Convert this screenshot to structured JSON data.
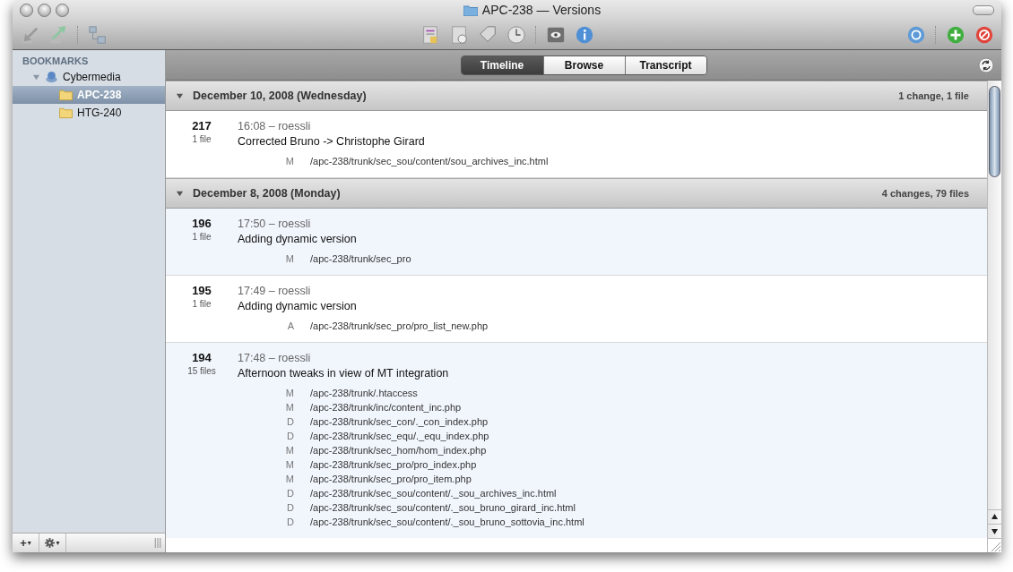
{
  "window": {
    "title": "APC-238 — Versions"
  },
  "sidebar": {
    "heading": "BOOKMARKS",
    "items": [
      {
        "label": "Cybermedia",
        "expanded": true,
        "selected": false,
        "children": [
          {
            "label": "APC-238",
            "selected": true
          },
          {
            "label": "HTG-240",
            "selected": false
          }
        ]
      }
    ]
  },
  "footer": {
    "add_button": "+",
    "menu_caret": "▾"
  },
  "tabs": [
    {
      "label": "Timeline",
      "selected": true
    },
    {
      "label": "Browse",
      "selected": false
    },
    {
      "label": "Transcript",
      "selected": false
    }
  ],
  "days": [
    {
      "date": "December 10, 2008 (Wednesday)",
      "summary": "1 change, 1 file",
      "expanded": true,
      "commits": [
        {
          "revision": "217",
          "files_count": "1 file",
          "time_author": "16:08 – roessli",
          "message": "Corrected Bruno -> Christophe Girard",
          "files": [
            {
              "status": "M",
              "path": "/apc-238/trunk/sec_sou/content/sou_archives_inc.html"
            }
          ]
        }
      ]
    },
    {
      "date": "December 8, 2008 (Monday)",
      "summary": "4 changes, 79 files",
      "expanded": true,
      "commits": [
        {
          "revision": "196",
          "files_count": "1 file",
          "time_author": "17:50 – roessli",
          "message": "Adding dynamic version",
          "files": [
            {
              "status": "M",
              "path": "/apc-238/trunk/sec_pro"
            }
          ]
        },
        {
          "revision": "195",
          "files_count": "1 file",
          "time_author": "17:49 – roessli",
          "message": "Adding dynamic version",
          "files": [
            {
              "status": "A",
              "path": "/apc-238/trunk/sec_pro/pro_list_new.php"
            }
          ]
        },
        {
          "revision": "194",
          "files_count": "15 files",
          "time_author": "17:48 – roessli",
          "message": "Afternoon tweaks in view of MT integration",
          "files": [
            {
              "status": "M",
              "path": "/apc-238/trunk/.htaccess"
            },
            {
              "status": "M",
              "path": "/apc-238/trunk/inc/content_inc.php"
            },
            {
              "status": "D",
              "path": "/apc-238/trunk/sec_con/._con_index.php"
            },
            {
              "status": "D",
              "path": "/apc-238/trunk/sec_equ/._equ_index.php"
            },
            {
              "status": "M",
              "path": "/apc-238/trunk/sec_hom/hom_index.php"
            },
            {
              "status": "M",
              "path": "/apc-238/trunk/sec_pro/pro_index.php"
            },
            {
              "status": "M",
              "path": "/apc-238/trunk/sec_pro/pro_item.php"
            },
            {
              "status": "D",
              "path": "/apc-238/trunk/sec_sou/content/._sou_archives_inc.html"
            },
            {
              "status": "D",
              "path": "/apc-238/trunk/sec_sou/content/._sou_bruno_girard_inc.html"
            },
            {
              "status": "D",
              "path": "/apc-238/trunk/sec_sou/content/._sou_bruno_sottovia_inc.html"
            }
          ]
        }
      ]
    }
  ]
}
